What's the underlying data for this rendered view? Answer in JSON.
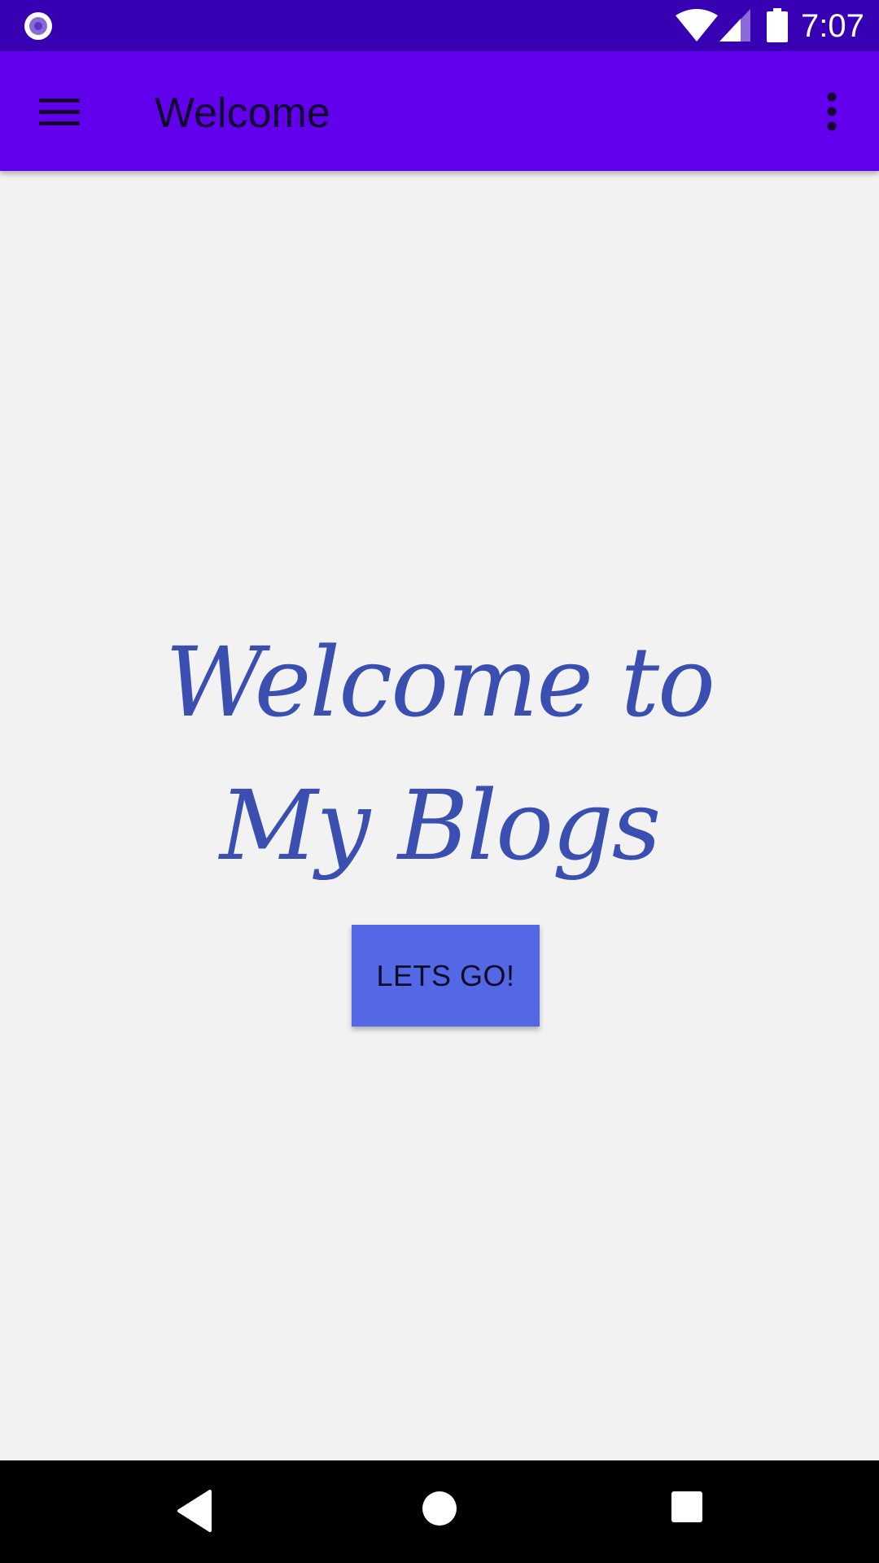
{
  "status_bar": {
    "time": "7:07",
    "left_icon": "circle-notification-icon",
    "wifi_icon": "wifi-icon",
    "signal_icon": "cell-signal-icon",
    "battery_icon": "battery-icon",
    "background": "#3700b3"
  },
  "app_bar": {
    "title": "Welcome",
    "menu_icon": "hamburger-menu-icon",
    "overflow_icon": "more-vert-icon",
    "background": "#6200ee"
  },
  "content": {
    "heading_line1": "Welcome to",
    "heading_line2": "My Blogs",
    "heading_color": "#3b4fb0",
    "button_label": "LETS GO!",
    "button_color": "#5468e5",
    "background": "#f2f2f3"
  },
  "nav_bar": {
    "back_icon": "back-triangle-icon",
    "home_icon": "home-circle-icon",
    "recents_icon": "recents-square-icon"
  }
}
